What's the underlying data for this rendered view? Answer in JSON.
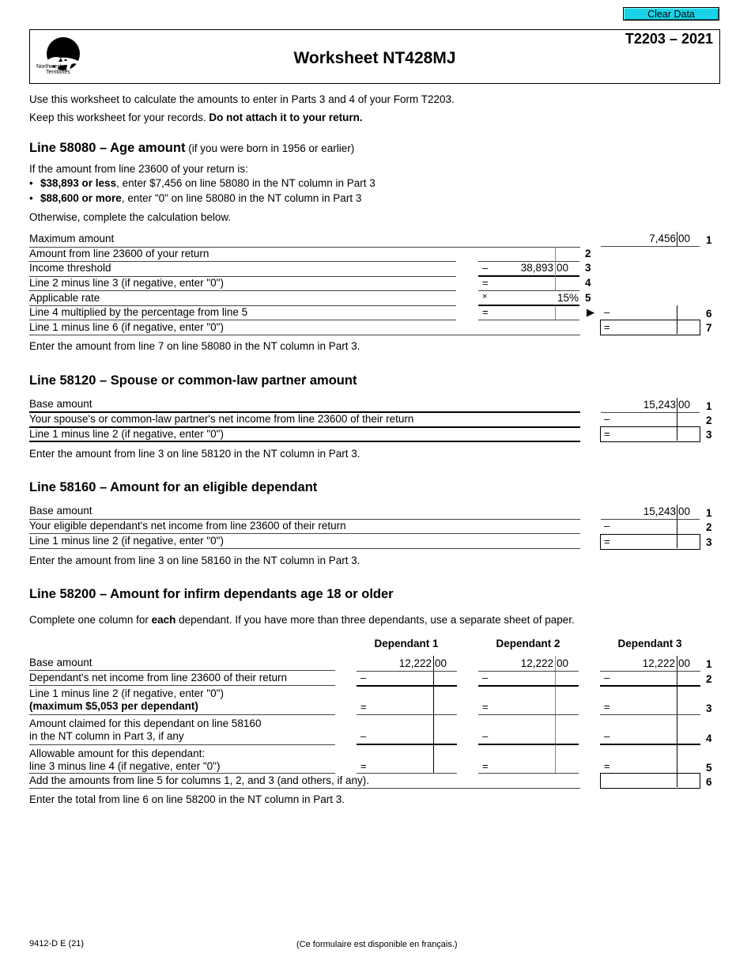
{
  "toolbar": {
    "clear_label": "Clear Data",
    "clear_color": "#1ad3e8"
  },
  "header": {
    "form_number": "T2203 – 2021",
    "title": "Worksheet NT428MJ",
    "logo_line1": "Northwest",
    "logo_line2": "Territories"
  },
  "intro": {
    "line1": "Use this worksheet to calculate the amounts to enter in Parts 3 and 4 of your Form T2203.",
    "line2_plain": "Keep this worksheet for your records. ",
    "line2_bold": "Do not attach it to your return."
  },
  "age": {
    "heading": "Line 58080 – Age amount",
    "heading_sub": " (if you were born in 1956 or earlier)",
    "if_text": "If the amount from line 23600 of your return is:",
    "bullets": [
      {
        "bold": "$38,893 or less",
        "rest": ", enter $7,456 on line 58080 in the NT column in Part 3"
      },
      {
        "bold": "$88,600 or more",
        "rest": ", enter \"0\" on line 58080 in the NT column in Part 3"
      }
    ],
    "otherwise": "Otherwise, complete the calculation below.",
    "rows": [
      {
        "label": "Maximum amount",
        "num": "1",
        "dollars": "7,456",
        "cents": "00"
      },
      {
        "label": "Amount from line 23600 of your return",
        "num": "2",
        "value": ""
      },
      {
        "label": "Income threshold",
        "num": "3",
        "op": "–",
        "dollars": "38,893",
        "cents": "00"
      },
      {
        "label": "Line 2 minus line 3 (if negative, enter \"0\")",
        "num": "4",
        "op": "=",
        "value": ""
      },
      {
        "label": "Applicable rate",
        "num": "5",
        "op": "×",
        "rate": "15%"
      },
      {
        "label": "Line 4 multiplied by the percentage from line 5",
        "num": "6",
        "op": "=",
        "op2": "–",
        "value": ""
      },
      {
        "label": "Line 1 minus line 6 (if negative, enter \"0\")",
        "num": "7",
        "op": "=",
        "value": ""
      }
    ],
    "arrow": "▶",
    "enter_text": "Enter the amount from line 7 on line 58080 in the NT column in Part 3."
  },
  "spouse": {
    "heading": "Line 58120 – Spouse or common-law partner amount",
    "rows": [
      {
        "label": "Base amount",
        "num": "1",
        "dollars": "15,243",
        "cents": "00"
      },
      {
        "label": "Your spouse's or common-law partner's net income from line 23600 of their return",
        "num": "2",
        "op": "–",
        "value": ""
      },
      {
        "label": "Line 1 minus line 2 (if negative, enter \"0\")",
        "num": "3",
        "op": "=",
        "value": ""
      }
    ],
    "enter_text": "Enter the amount from line 3 on line 58120 in the NT column in Part 3."
  },
  "eligible": {
    "heading": "Line 58160 – Amount for an eligible dependant",
    "rows": [
      {
        "label": "Base amount",
        "num": "1",
        "dollars": "15,243",
        "cents": "00"
      },
      {
        "label": "Your eligible dependant's net income from line 23600 of their return",
        "num": "2",
        "op": "–",
        "value": ""
      },
      {
        "label": "Line 1 minus line 2 (if negative, enter \"0\")",
        "num": "3",
        "op": "=",
        "value": ""
      }
    ],
    "enter_text": "Enter the amount from line 3 on line 58160 in the NT column in Part 3."
  },
  "infirm": {
    "heading": "Line 58200 – Amount for infirm dependants age 18 or older",
    "intro_plain1": "Complete one column for ",
    "intro_bold": "each",
    "intro_plain2": " dependant. If you have more than three dependants, use a separate sheet of paper.",
    "columns": [
      "Dependant 1",
      "Dependant 2",
      "Dependant 3"
    ],
    "rows": [
      {
        "label": "Base amount",
        "num": "1",
        "dollars": "12,222",
        "cents": "00"
      },
      {
        "label": "Dependant's net income from line 23600 of their return",
        "num": "2",
        "op": "–"
      },
      {
        "label": "Line 1 minus line 2 (if negative, enter \"0\")",
        "label_bold": "(maximum $5,053 per dependant)",
        "num": "3",
        "op": "="
      },
      {
        "label": "Amount claimed for this dependant on line 58160",
        "label2": "in the NT column in Part 3, if any",
        "num": "4",
        "op": "–"
      },
      {
        "label": "Allowable amount for this dependant:",
        "label2": "line 3 minus line 4 (if negative, enter \"0\")",
        "num": "5",
        "op": "="
      },
      {
        "label": "Add the amounts from line 5 for columns 1, 2, and 3 (and others, if any).",
        "num": "6",
        "value": ""
      }
    ],
    "enter_text": "Enter the total from line 6 on line 58200 in the NT column in Part 3."
  },
  "footer": {
    "form_code": "9412-D E (21)",
    "french_note": "(Ce formulaire est disponible en français.)"
  }
}
